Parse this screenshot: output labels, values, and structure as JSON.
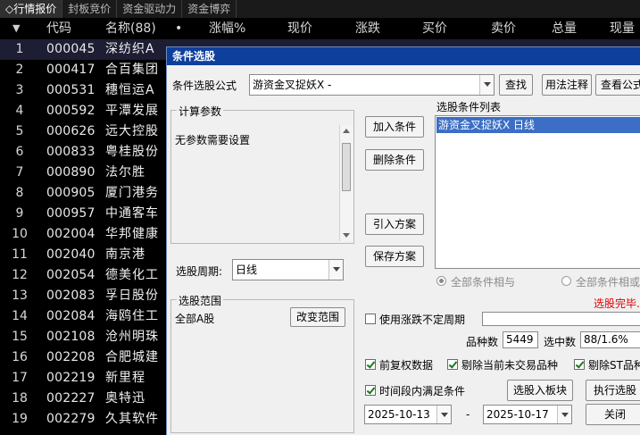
{
  "tabs": [
    {
      "label": "◇行情报价",
      "active": true
    },
    {
      "label": "封板竞价",
      "active": false
    },
    {
      "label": "资金驱动力",
      "active": false
    },
    {
      "label": "资金博弈",
      "active": false
    }
  ],
  "table": {
    "headers": {
      "sort": "▼",
      "code": "代码",
      "name": "名称(88)",
      "dot": "•",
      "pct": "涨幅%",
      "price": "现价",
      "change": "涨跌",
      "bid": "买价",
      "ask": "卖价",
      "volume": "总量",
      "curvol": "现量"
    },
    "rows": [
      {
        "idx": "1",
        "code": "000045",
        "name": "深纺织A"
      },
      {
        "idx": "2",
        "code": "000417",
        "name": "合百集团"
      },
      {
        "idx": "3",
        "code": "000531",
        "name": "穗恒运A"
      },
      {
        "idx": "4",
        "code": "000592",
        "name": "平潭发展"
      },
      {
        "idx": "5",
        "code": "000626",
        "name": "远大控股"
      },
      {
        "idx": "6",
        "code": "000833",
        "name": "粤桂股份"
      },
      {
        "idx": "7",
        "code": "000890",
        "name": "法尔胜"
      },
      {
        "idx": "8",
        "code": "000905",
        "name": "厦门港务"
      },
      {
        "idx": "9",
        "code": "000957",
        "name": "中通客车"
      },
      {
        "idx": "10",
        "code": "002004",
        "name": "华邦健康"
      },
      {
        "idx": "11",
        "code": "002040",
        "name": "南京港"
      },
      {
        "idx": "12",
        "code": "002054",
        "name": "德美化工"
      },
      {
        "idx": "13",
        "code": "002083",
        "name": "孚日股份"
      },
      {
        "idx": "14",
        "code": "002084",
        "name": "海鸥住工"
      },
      {
        "idx": "15",
        "code": "002108",
        "name": "沧州明珠"
      },
      {
        "idx": "16",
        "code": "002208",
        "name": "合肥城建"
      },
      {
        "idx": "17",
        "code": "002219",
        "name": "新里程"
      },
      {
        "idx": "18",
        "code": "002227",
        "name": "奥特迅"
      },
      {
        "idx": "19",
        "code": "002279",
        "name": "久其软件"
      }
    ]
  },
  "dialog": {
    "title": "条件选股",
    "formula_label": "条件选股公式",
    "formula_value": "游资金叉捉妖X  -",
    "find_btn": "查找",
    "usage_btn": "用法注释",
    "view_btn": "查看公式",
    "calc_group": "计算参数",
    "no_params": "无参数需要设置",
    "add_btn": "加入条件",
    "del_btn": "删除条件",
    "import_btn": "引入方案",
    "save_btn": "保存方案",
    "cond_list_label": "选股条件列表",
    "cond_item": "游资金叉捉妖X  日线",
    "period_label": "选股周期:",
    "period_value": "日线",
    "radio_and": "全部条件相与",
    "radio_or": "全部条件相或",
    "status": "选股完毕.",
    "status_color": "#e00000",
    "scope_group": "选股范围",
    "scope_value": "全部A股",
    "change_scope_btn": "改变范围",
    "use_pct_label": "使用涨跌不定周期",
    "count_label": "品种数",
    "count_value": "5449",
    "selected_label": "选中数",
    "selected_value": "88/1.6%",
    "pre_adjust": "前复权数据",
    "exclude_notrade": "剔除当前未交易品种",
    "exclude_st": "剔除ST品种",
    "time_range_label": "时间段内满足条件",
    "to_block_btn": "选股入板块",
    "exec_btn": "执行选股",
    "date_from": "2025-10-13",
    "date_sep": "-",
    "date_to": "2025-10-17",
    "close_btn": "关闭"
  }
}
